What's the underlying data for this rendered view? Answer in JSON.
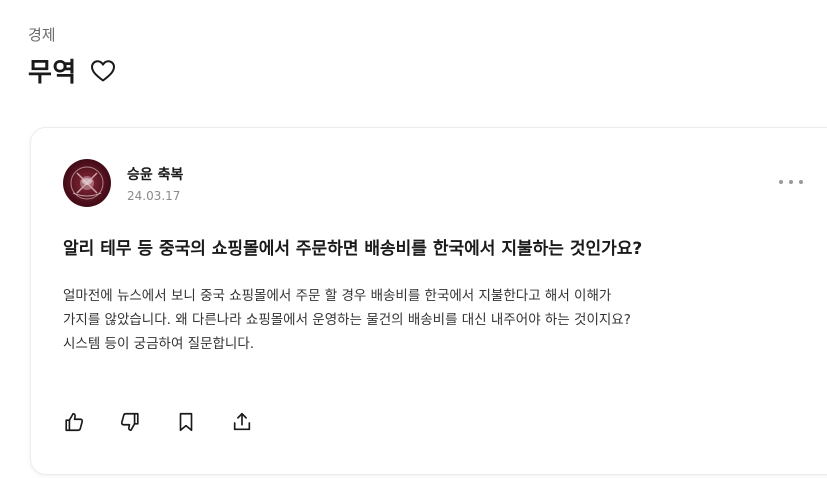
{
  "header": {
    "category": "경제",
    "title": "무역"
  },
  "post": {
    "author": "승윤 축복",
    "date": "24.03.17",
    "question": "알리 테무 등 중국의 쇼핑몰에서 주문하면 배송비를 한국에서 지불하는 것인가요?",
    "body_lines": [
      "얼마전에 뉴스에서 보니 중국 쇼핑몰에서 주문 할 경우 배송비를 한국에서 지불한다고 해서 이해가",
      "가지를 않았습니다. 왜 다른나라 쇼핑몰에서 운영하는 물건의 배송비를 대신 내주어야 하는 것이지요?",
      "시스템 등이 궁금하여 질문합니다."
    ]
  },
  "icons": {
    "favorite": "heart-outline-icon",
    "more": "more-horizontal-icon",
    "like": "thumbs-up-icon",
    "dislike": "thumbs-down-icon",
    "bookmark": "bookmark-icon",
    "share": "share-icon"
  },
  "colors": {
    "text_primary": "#1a1a1a",
    "text_secondary": "#6b6b6b",
    "avatar_bg": "#4a0e1a"
  }
}
